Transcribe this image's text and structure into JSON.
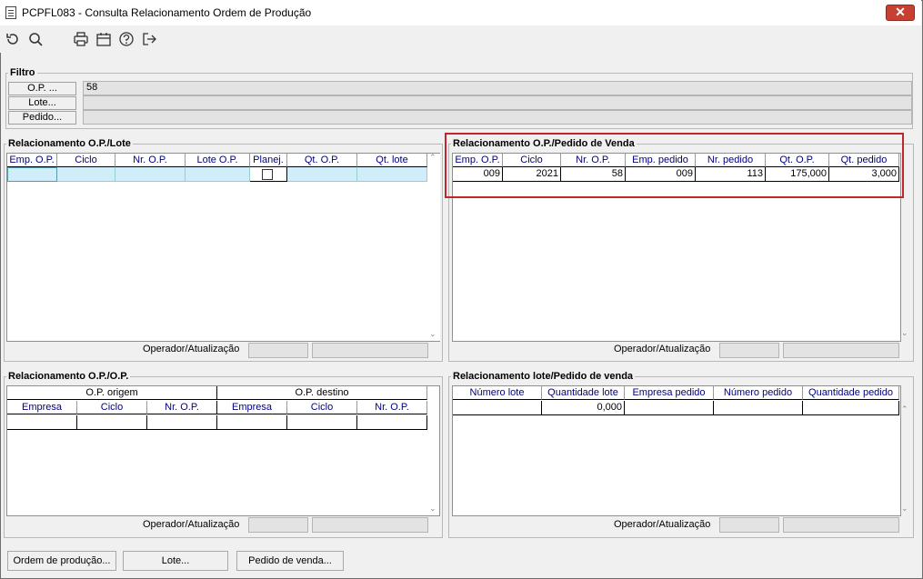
{
  "window": {
    "title": "PCPFL083 - Consulta Relacionamento Ordem de Produção",
    "close_label": "✕"
  },
  "toolbar": {
    "icons": [
      "refresh-icon",
      "search-icon",
      "print-icon",
      "calendar-icon",
      "help-icon",
      "exit-icon"
    ]
  },
  "filtro": {
    "legend": "Filtro",
    "op_label": "O.P. ...",
    "op_value": "58",
    "lote_label": "Lote...",
    "lote_value": "",
    "pedido_label": "Pedido...",
    "pedido_value": ""
  },
  "op_lote": {
    "legend": "Relacionamento O.P./Lote",
    "headers": [
      "Emp. O.P.",
      "Ciclo",
      "Nr. O.P.",
      "Lote O.P.",
      "Planej.",
      "Qt. O.P.",
      "Qt. lote"
    ],
    "footer_label": "Operador/Atualização"
  },
  "op_pedido": {
    "legend": "Relacionamento O.P./Pedido de Venda",
    "headers": [
      "Emp. O.P.",
      "Ciclo",
      "Nr. O.P.",
      "Emp. pedido",
      "Nr. pedido",
      "Qt. O.P.",
      "Qt. pedido"
    ],
    "row": [
      "009",
      "2021",
      "58",
      "009",
      "113",
      "175,000",
      "3,000"
    ],
    "footer_label": "Operador/Atualização"
  },
  "op_op": {
    "legend": "Relacionamento O.P./O.P.",
    "group_origem": "O.P. origem",
    "group_destino": "O.P. destino",
    "headers": [
      "Empresa",
      "Ciclo",
      "Nr. O.P.",
      "Empresa",
      "Ciclo",
      "Nr. O.P."
    ],
    "footer_label": "Operador/Atualização"
  },
  "lote_pedido": {
    "legend": "Relacionamento lote/Pedido de venda",
    "headers": [
      "Número lote",
      "Quantidade lote",
      "Empresa pedido",
      "Número pedido",
      "Quantidade pedido"
    ],
    "row": [
      "",
      "0,000",
      "",
      "",
      ""
    ],
    "footer_label": "Operador/Atualização"
  },
  "buttons": {
    "ordem": "Ordem de produção...",
    "lote": "Lote...",
    "pedido": "Pedido de venda..."
  },
  "colors": {
    "header_text": "#000080",
    "selected_row": "#cfeefa",
    "highlight": "#c0262c",
    "close": "#c84031"
  }
}
